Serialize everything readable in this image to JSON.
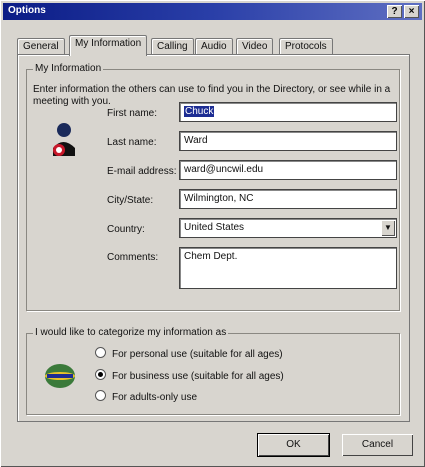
{
  "window": {
    "title": "Options",
    "help_glyph": "?",
    "close_glyph": "×"
  },
  "tabs": [
    "General",
    "My Information",
    "Calling",
    "Audio",
    "Video",
    "Protocols"
  ],
  "my_info": {
    "group_title": "My Information",
    "intro": "Enter information the others can use to find you in the Directory, or see while in a meeting with you.",
    "first_name_label": "First name:",
    "first_name_value": "Chuck",
    "last_name_label": "Last name:",
    "last_name_value": "Ward",
    "email_label": "E-mail address:",
    "email_value": "ward@uncwil.edu",
    "city_label": "City/State:",
    "city_value": "Wilmington, NC",
    "country_label": "Country:",
    "country_value": "United States",
    "comments_label": "Comments:",
    "comments_value": "Chem Dept."
  },
  "categorize": {
    "group_title": "I would like to categorize my information as",
    "options": [
      "For personal use (suitable for all ages)",
      "For business use (suitable for all ages)",
      "For adults-only use"
    ],
    "selected_index": 1
  },
  "buttons": {
    "ok": "OK",
    "cancel": "Cancel"
  }
}
